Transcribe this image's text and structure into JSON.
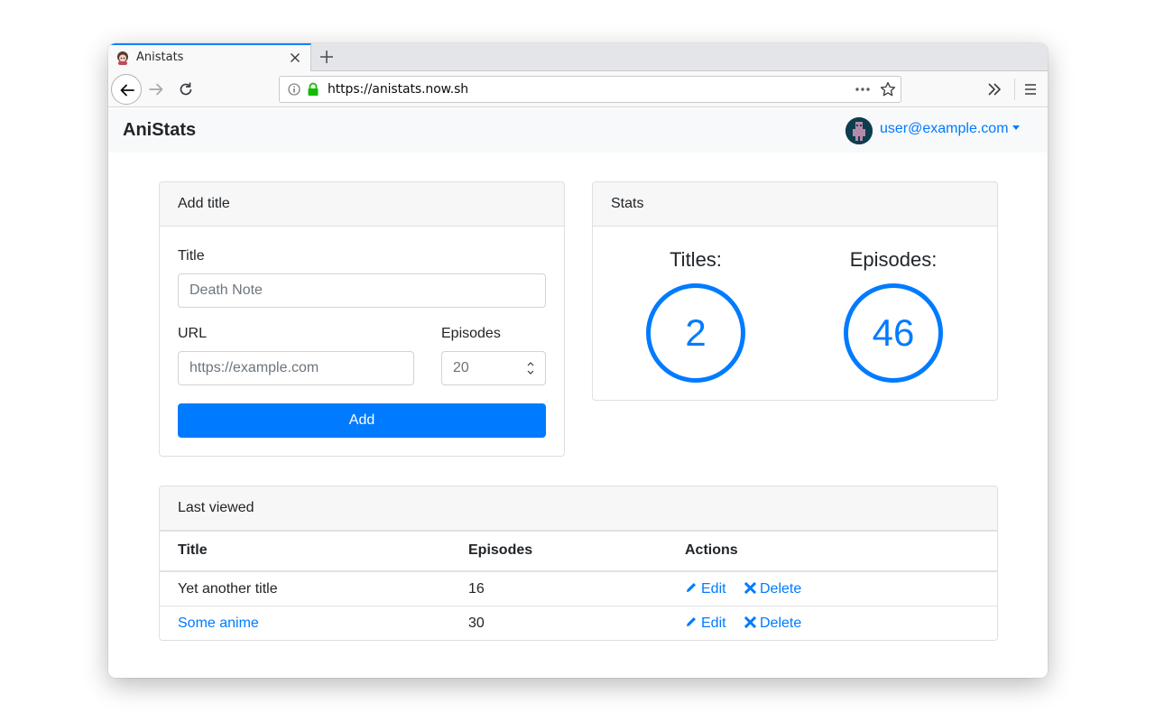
{
  "browser": {
    "tab_title": "Anistats",
    "url": "https://anistats.now.sh"
  },
  "navbar": {
    "brand": "AniStats",
    "user_email": "user@example.com"
  },
  "add_title_card": {
    "header": "Add title",
    "title_label": "Title",
    "title_placeholder": "Death Note",
    "url_label": "URL",
    "url_placeholder": "https://example.com",
    "episodes_label": "Episodes",
    "episodes_placeholder": "20",
    "add_button": "Add"
  },
  "stats_card": {
    "header": "Stats",
    "titles_label": "Titles:",
    "titles_value": "2",
    "episodes_label": "Episodes:",
    "episodes_value": "46"
  },
  "last_viewed": {
    "header": "Last viewed",
    "columns": [
      "Title",
      "Episodes",
      "Actions"
    ],
    "rows": [
      {
        "title": "Yet another title",
        "episodes": "16",
        "is_link": false
      },
      {
        "title": "Some anime",
        "episodes": "30",
        "is_link": true
      }
    ],
    "edit_label": "Edit",
    "delete_label": "Delete"
  },
  "colors": {
    "primary": "#007bff",
    "navbar_bg": "#f8f9fa",
    "card_header_bg": "#f7f7f7"
  }
}
